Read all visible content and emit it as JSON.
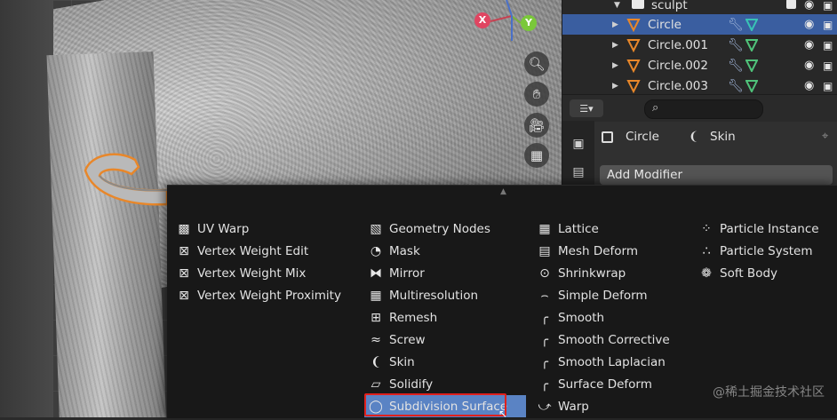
{
  "outliner": {
    "rows": [
      {
        "name": "sculpt",
        "type": "collection",
        "selected": false
      },
      {
        "name": "Circle",
        "type": "mesh",
        "selected": true
      },
      {
        "name": "Circle.001",
        "type": "mesh",
        "selected": false
      },
      {
        "name": "Circle.002",
        "type": "mesh",
        "selected": false
      },
      {
        "name": "Circle.003",
        "type": "mesh",
        "selected": false
      }
    ]
  },
  "gizmo": {
    "x_label": "X",
    "y_label": "Y"
  },
  "properties": {
    "object_name": "Circle",
    "modifier_name": "Skin",
    "add_modifier_label": "Add Modifier"
  },
  "menu": {
    "columns": [
      [
        {
          "label": "UV Warp",
          "icon": "uv-warp-icon"
        },
        {
          "label": "Vertex Weight Edit",
          "icon": "vertex-weight-icon"
        },
        {
          "label": "Vertex Weight Mix",
          "icon": "vertex-weight-icon"
        },
        {
          "label": "Vertex Weight Proximity",
          "icon": "vertex-weight-icon"
        }
      ],
      [
        {
          "label": "Geometry Nodes",
          "icon": "geometry-nodes-icon"
        },
        {
          "label": "Mask",
          "icon": "mask-icon"
        },
        {
          "label": "Mirror",
          "icon": "mirror-icon"
        },
        {
          "label": "Multiresolution",
          "icon": "multires-icon"
        },
        {
          "label": "Remesh",
          "icon": "remesh-icon"
        },
        {
          "label": "Screw",
          "icon": "screw-icon"
        },
        {
          "label": "Skin",
          "icon": "skin-icon"
        },
        {
          "label": "Solidify",
          "icon": "solidify-icon"
        },
        {
          "label": "Subdivision Surface",
          "icon": "subsurf-icon",
          "highlighted": true
        }
      ],
      [
        {
          "label": "Lattice",
          "icon": "lattice-icon"
        },
        {
          "label": "Mesh Deform",
          "icon": "mesh-deform-icon"
        },
        {
          "label": "Shrinkwrap",
          "icon": "shrinkwrap-icon"
        },
        {
          "label": "Simple Deform",
          "icon": "simple-deform-icon"
        },
        {
          "label": "Smooth",
          "icon": "smooth-icon"
        },
        {
          "label": "Smooth Corrective",
          "icon": "smooth-icon"
        },
        {
          "label": "Smooth Laplacian",
          "icon": "smooth-icon"
        },
        {
          "label": "Surface Deform",
          "icon": "smooth-icon"
        },
        {
          "label": "Warp",
          "icon": "warp-icon"
        }
      ],
      [
        {
          "label": "Particle Instance",
          "icon": "particle-instance-icon"
        },
        {
          "label": "Particle System",
          "icon": "particle-system-icon"
        },
        {
          "label": "Soft Body",
          "icon": "soft-body-icon"
        }
      ]
    ]
  },
  "watermark": "@稀土掘金技术社区",
  "colors": {
    "selection": "#3a5ea0",
    "highlight": "#5a83c4",
    "annotation": "#e0201c",
    "accent_orange": "#e8872a"
  }
}
